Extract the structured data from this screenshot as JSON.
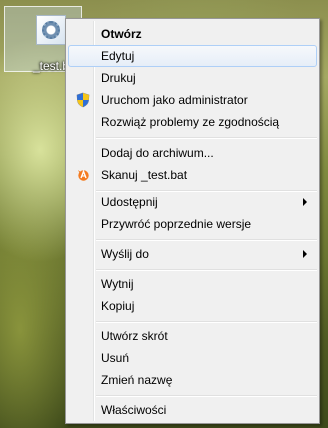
{
  "desktop": {
    "file_label": "_test.bat",
    "file_icon": "batch-file-gear-icon"
  },
  "context_menu": {
    "items": [
      {
        "label": "Otwórz"
      },
      {
        "label": "Edytuj"
      },
      {
        "label": "Drukuj"
      },
      {
        "label": "Uruchom jako administrator",
        "icon": "uac-shield-icon"
      },
      {
        "label": "Rozwiąż problemy ze zgodnością"
      },
      {
        "label": "Dodaj do archiwum..."
      },
      {
        "label": "Skanuj _test.bat",
        "icon": "avast-antivirus-icon"
      },
      {
        "label": "Udostępnij"
      },
      {
        "label": "Przywróć poprzednie wersje"
      },
      {
        "label": "Wyślij do"
      },
      {
        "label": "Wytnij"
      },
      {
        "label": "Kopiuj"
      },
      {
        "label": "Utwórz skrót"
      },
      {
        "label": "Usuń"
      },
      {
        "label": "Zmień nazwę"
      },
      {
        "label": "Właściwości"
      }
    ],
    "highlight_color": "#aecff7",
    "default_item": "Otwórz",
    "hovered_item": "Edytuj"
  }
}
